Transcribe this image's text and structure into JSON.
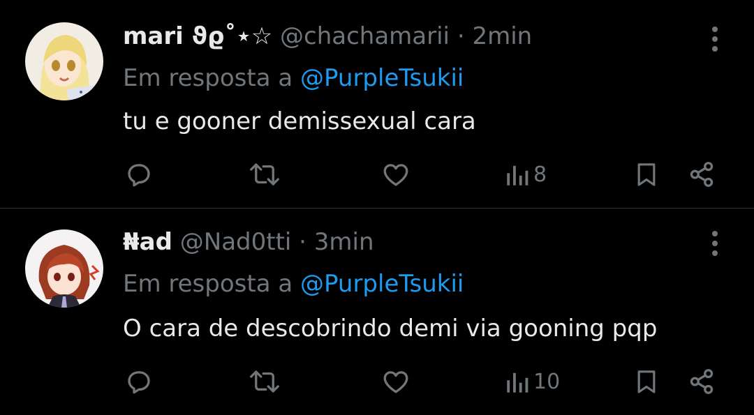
{
  "tweets": [
    {
      "display_name": "mari ϑϱ˚⋆☆",
      "handle": "@chachamarii",
      "separator": "·",
      "time": "2min",
      "reply_prefix": "Em resposta a",
      "reply_to": "@PurpleTsukii",
      "text": "tu e gooner demissexual cara",
      "views": "8"
    },
    {
      "display_name": "₦ad",
      "handle": "@Nad0tti",
      "separator": "·",
      "time": "3min",
      "reply_prefix": "Em resposta a",
      "reply_to": "@PurpleTsukii",
      "text": "O cara de descobrindo demi via gooning pqp",
      "views": "10"
    }
  ],
  "icons": [
    "reply-icon",
    "retweet-icon",
    "like-icon",
    "views-icon",
    "bookmark-icon",
    "share-icon",
    "more-icon"
  ],
  "colors": {
    "background": "#000000",
    "text": "#e7e9ea",
    "secondary": "#71767b",
    "link": "#1d9bf0",
    "divider": "#2f3336"
  }
}
